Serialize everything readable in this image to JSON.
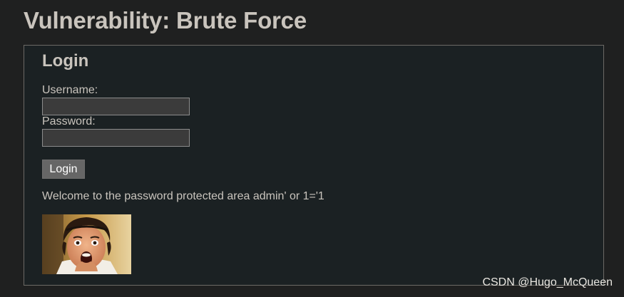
{
  "page": {
    "title": "Vulnerability: Brute Force"
  },
  "login_panel": {
    "title": "Login",
    "username_label": "Username:",
    "username_value": "",
    "password_label": "Password:",
    "password_value": "",
    "submit_label": "Login",
    "welcome_message": "Welcome to the password protected area admin' or 1='1"
  },
  "watermark": "CSDN @Hugo_McQueen",
  "colors": {
    "background": "#1f2020",
    "panel_background": "#1b2123",
    "text": "#c9c4bd",
    "button": "#666666"
  }
}
